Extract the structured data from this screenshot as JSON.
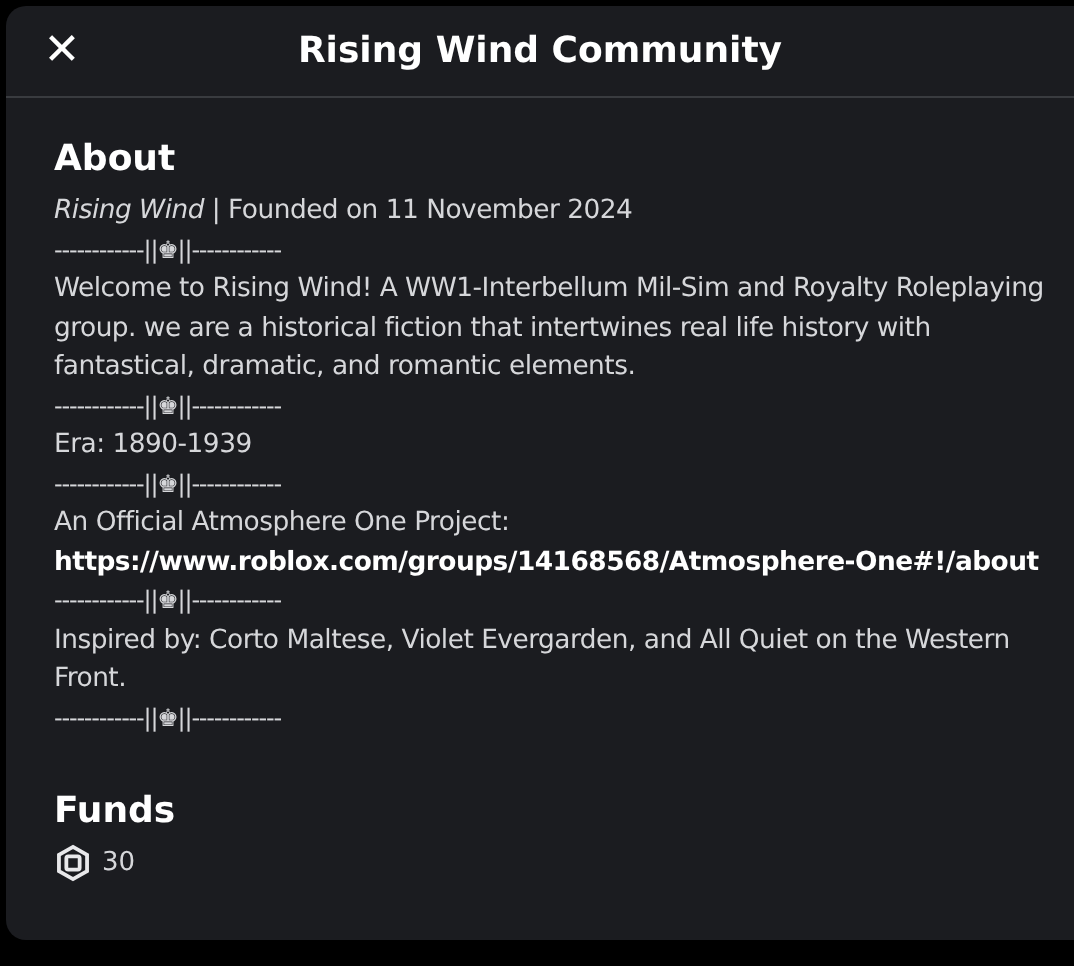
{
  "window": {
    "title": "Rising Wind Community",
    "close_glyph": "✕"
  },
  "about": {
    "heading": "About",
    "lines": [
      {
        "kind": "text",
        "text": "*Rising Wind* | Founded on 11 November 2024"
      },
      {
        "kind": "divider",
        "text": "------------||♚||------------"
      },
      {
        "kind": "text",
        "text": "Welcome to Rising Wind! A WW1-Interbellum Mil-Sim and Royalty Roleplaying group. we are a historical fiction that intertwines real life history with fantastical, dramatic, and romantic elements."
      },
      {
        "kind": "divider",
        "text": "------------||♚||------------"
      },
      {
        "kind": "text",
        "text": "Era: 1890-1939"
      },
      {
        "kind": "divider",
        "text": "------------||♚||------------"
      },
      {
        "kind": "text",
        "text": "An Official Atmosphere One Project:"
      },
      {
        "kind": "link",
        "text": "https://www.roblox.com/groups/14168568/Atmosphere-One#!/about"
      },
      {
        "kind": "divider",
        "text": "------------||♚||------------"
      },
      {
        "kind": "text",
        "text": "Inspired by: Corto Maltese, Violet Evergarden, and All Quiet on the Western Front."
      },
      {
        "kind": "divider",
        "text": "------------||♚||------------"
      }
    ]
  },
  "funds": {
    "heading": "Funds",
    "amount": "30"
  }
}
